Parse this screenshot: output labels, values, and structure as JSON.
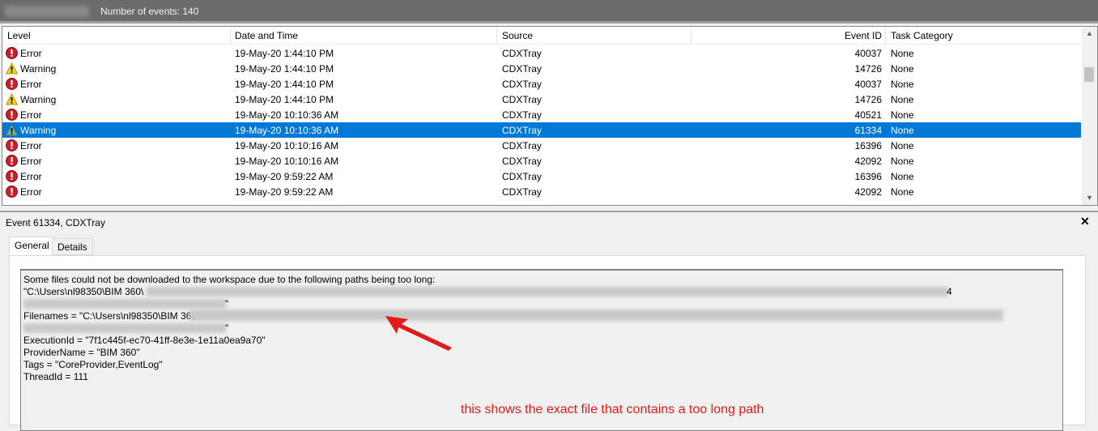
{
  "header": {
    "event_count": "Number of events: 140"
  },
  "columns": [
    "Level",
    "Date and Time",
    "Source",
    "Event ID",
    "Task Category"
  ],
  "rows": [
    {
      "level": "Error",
      "date": "19-May-20 1:44:10 PM",
      "source": "CDXTray",
      "id": "40037",
      "task": "None"
    },
    {
      "level": "Warning",
      "date": "19-May-20 1:44:10 PM",
      "source": "CDXTray",
      "id": "14726",
      "task": "None"
    },
    {
      "level": "Error",
      "date": "19-May-20 1:44:10 PM",
      "source": "CDXTray",
      "id": "40037",
      "task": "None"
    },
    {
      "level": "Warning",
      "date": "19-May-20 1:44:10 PM",
      "source": "CDXTray",
      "id": "14726",
      "task": "None"
    },
    {
      "level": "Error",
      "date": "19-May-20 10:10:36 AM",
      "source": "CDXTray",
      "id": "40521",
      "task": "None"
    },
    {
      "level": "Warning",
      "date": "19-May-20 10:10:36 AM",
      "source": "CDXTray",
      "id": "61334",
      "task": "None",
      "selected": true
    },
    {
      "level": "Error",
      "date": "19-May-20 10:10:16 AM",
      "source": "CDXTray",
      "id": "16396",
      "task": "None"
    },
    {
      "level": "Error",
      "date": "19-May-20 10:10:16 AM",
      "source": "CDXTray",
      "id": "42092",
      "task": "None"
    },
    {
      "level": "Error",
      "date": "19-May-20 9:59:22 AM",
      "source": "CDXTray",
      "id": "16396",
      "task": "None"
    },
    {
      "level": "Error",
      "date": "19-May-20 9:59:22 AM",
      "source": "CDXTray",
      "id": "42092",
      "task": "None"
    }
  ],
  "detail": {
    "title": "Event 61334, CDXTray",
    "close": "✕",
    "tabs": [
      "General",
      "Details"
    ],
    "lines": [
      "Some files could not be downloaded to the workspace due to the following paths being too long:",
      " \"C:\\Users\\nl98350\\BIM 360\\",
      "\"",
      "Filenames = \"C:\\Users\\nl98350\\BIM 360\\",
      "\"",
      "ExecutionId = \"7f1c445f-ec70-41ff-8e3e-1e11a0ea9a70\"",
      "ProviderName = \"BIM 360\"",
      "Tags = \"CoreProvider,EventLog\"",
      "ThreadId = 111"
    ]
  },
  "annotation": "this shows the exact file that contains a too long path",
  "colors": {
    "selected": "#0078d7",
    "annotation": "#e21a1a"
  }
}
